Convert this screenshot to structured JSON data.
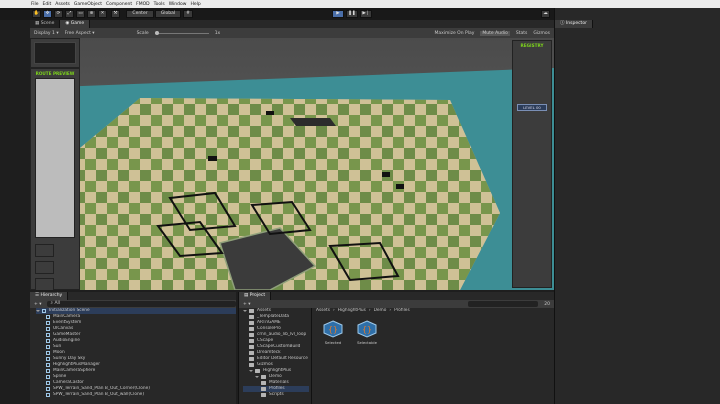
{
  "menu": [
    "File",
    "Edit",
    "Assets",
    "GameObject",
    "Component",
    "FMOD",
    "Tools",
    "Window",
    "Help"
  ],
  "toolbar": {
    "center": "Center",
    "global": "Global",
    "account": "Account",
    "layers": "Layers",
    "layout": "Layout"
  },
  "scene_tabs": {
    "scene": "Scene",
    "game": "Game"
  },
  "game_bar": {
    "display": "Display 1",
    "aspect": "Free Aspect",
    "scale_label": "Scale",
    "scale_value": "1x",
    "maximize": "Maximize On Play",
    "mute": "Mute Audio",
    "stats": "Stats",
    "gizmos": "Gizmos"
  },
  "game_ui": {
    "route_preview": "ROUTE PREVIEW",
    "registry": "REGISTRY",
    "level": "LEVEL 00"
  },
  "inspector": {
    "title": "Inspector"
  },
  "hierarchy": {
    "title": "Hierarchy",
    "search_label": "All",
    "items": [
      "Initialization Scene",
      "MainCamera",
      "EventSystem",
      "UICanvas",
      "GameMaster",
      "AudioEngine",
      "Sun",
      "Moon",
      "Sunny Day Sky",
      "HighlightPlusManager",
      "MainCameraSphere",
      "Spline",
      "CameraCastor",
      "SPW_Terrain_Sand_Plan B_Out_Corner(Clone)",
      "SPW_Terrain_Sand_Plan B_Out_wall(Clone)"
    ]
  },
  "project": {
    "title": "Project",
    "tree": [
      "Assets",
      "_TemplateData",
      "ARTnGAME",
      "ConsolePro",
      "crnn_audio_lib_lvl_loop",
      "CScape",
      "CScapeCustomBuild",
      "Dreamteck",
      "Editor Default Resource",
      "Gizmos",
      "HighlightPlus",
      "Demo",
      "Materials",
      "Profiles",
      "Scripts"
    ],
    "breadcrumb": [
      "Assets",
      "HighlightPlus",
      "Demo",
      "Profiles"
    ],
    "files": [
      "Selected",
      "Selectable"
    ],
    "count": "20"
  },
  "colors": {
    "accent": "#4a6ea8",
    "neon": "#7dd41c",
    "sea": "#3d8e95",
    "grass": "#4e7a2e",
    "sand": "#cfc196"
  }
}
